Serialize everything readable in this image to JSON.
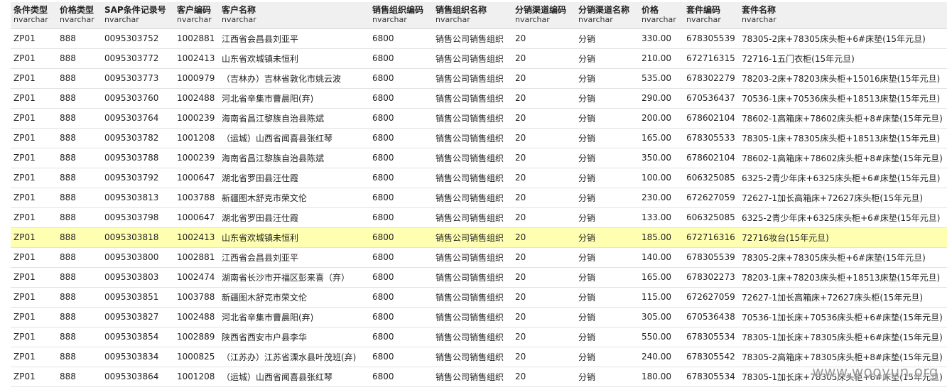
{
  "table": {
    "columns": [
      {
        "name": "条件类型",
        "type": "nvarchar"
      },
      {
        "name": "价格类型",
        "type": "nvarchar"
      },
      {
        "name": "SAP条件记录号",
        "type": "nvarchar"
      },
      {
        "name": "客户编码",
        "type": "nvarchar"
      },
      {
        "name": "客户名称",
        "type": "nvarchar"
      },
      {
        "name": "销售组织编码",
        "type": "nvarchar"
      },
      {
        "name": "销售组织名称",
        "type": "nvarchar"
      },
      {
        "name": "分销渠道编码",
        "type": "nvarchar"
      },
      {
        "name": "分销渠道名称",
        "type": "nvarchar"
      },
      {
        "name": "价格",
        "type": "nvarchar"
      },
      {
        "name": "套件编码",
        "type": "nvarchar"
      },
      {
        "name": "套件名称",
        "type": "nvarchar"
      }
    ],
    "rows": [
      [
        "ZP01",
        "888",
        "0095303752",
        "1002881",
        "江西省会昌县刘亚平",
        "6800",
        "销售公司销售组织",
        "20",
        "分销",
        "330.00",
        "678305539",
        "78305-2床+78305床头柜+6#床垫(15年元旦)"
      ],
      [
        "ZP01",
        "888",
        "0095303772",
        "1002413",
        "山东省欢城镇未恒利",
        "6800",
        "销售公司销售组织",
        "20",
        "分销",
        "210.00",
        "672716315",
        "72716-1五门衣柜(15年元旦)"
      ],
      [
        "ZP01",
        "888",
        "0095303773",
        "1000979",
        "（吉林办）吉林省敦化市姚云波",
        "6800",
        "销售公司销售组织",
        "20",
        "分销",
        "535.00",
        "678302279",
        "78203-2床+78203床头柜+15016床垫(15年元旦)"
      ],
      [
        "ZP01",
        "888",
        "0095303760",
        "1002488",
        "河北省辛集市曹晨阳(弃)",
        "6800",
        "销售公司销售组织",
        "20",
        "分销",
        "290.00",
        "670536437",
        "70536-1床+70536床头柜+18513床垫(15年元旦)"
      ],
      [
        "ZP01",
        "888",
        "0095303764",
        "1000239",
        "海南省昌江黎族自治县陈斌",
        "6800",
        "销售公司销售组织",
        "20",
        "分销",
        "200.00",
        "678602104",
        "78602-1高箱床+78602床头柜+8#床垫(15年元旦)"
      ],
      [
        "ZP01",
        "888",
        "0095303782",
        "1001208",
        "（运城）山西省闻喜县张红琴",
        "6800",
        "销售公司销售组织",
        "20",
        "分销",
        "165.00",
        "678305533",
        "78305-1床+78305床头柜+18513床垫(15年元旦)"
      ],
      [
        "ZP01",
        "888",
        "0095303788",
        "1000239",
        "海南省昌江黎族自治县陈斌",
        "6800",
        "销售公司销售组织",
        "20",
        "分销",
        "350.00",
        "678602104",
        "78602-1高箱床+78602床头柜+8#床垫(15年元旦)"
      ],
      [
        "ZP01",
        "888",
        "0095303792",
        "1000647",
        "湖北省罗田县汪仕霞",
        "6800",
        "销售公司销售组织",
        "20",
        "分销",
        "100.00",
        "606325085",
        "6325-2青少年床+6325床头柜+6#床垫(15年元旦)"
      ],
      [
        "ZP01",
        "888",
        "0095303813",
        "1003788",
        "新疆图木舒克市荣文伦",
        "6800",
        "销售公司销售组织",
        "20",
        "分销",
        "230.00",
        "672627059",
        "72627-1加长高箱床+72627床头柜(15年元旦)"
      ],
      [
        "ZP01",
        "888",
        "0095303798",
        "1000647",
        "湖北省罗田县汪仕霞",
        "6800",
        "销售公司销售组织",
        "20",
        "分销",
        "133.00",
        "606325085",
        "6325-2青少年床+6325床头柜+6#床垫(15年元旦)"
      ],
      [
        "ZP01",
        "888",
        "0095303818",
        "1002413",
        "山东省欢城镇未恒利",
        "6800",
        "销售公司销售组织",
        "20",
        "分销",
        "185.00",
        "672716316",
        "72716妆台(15年元旦)"
      ],
      [
        "ZP01",
        "888",
        "0095303800",
        "1002881",
        "江西省会昌县刘亚平",
        "6800",
        "销售公司销售组织",
        "20",
        "分销",
        "140.00",
        "678305539",
        "78305-2床+78305床头柜+6#床垫(15年元旦)"
      ],
      [
        "ZP01",
        "888",
        "0095303803",
        "1002474",
        "湖南省长沙市开福区彭来喜（弃）",
        "6800",
        "销售公司销售组织",
        "20",
        "分销",
        "165.00",
        "678302273",
        "78203-1床+78203床头柜+18513床垫(15年元旦)"
      ],
      [
        "ZP01",
        "888",
        "0095303851",
        "1003788",
        "新疆图木舒克市荣文伦",
        "6800",
        "销售公司销售组织",
        "20",
        "分销",
        "115.00",
        "672627059",
        "72627-1加长高箱床+72627床头柜(15年元旦)"
      ],
      [
        "ZP01",
        "888",
        "0095303827",
        "1002488",
        "河北省辛集市曹晨阳(弃)",
        "6800",
        "销售公司销售组织",
        "20",
        "分销",
        "305.00",
        "670536438",
        "70536-1加长床+70536床头柜+6#床垫(15年元旦)"
      ],
      [
        "ZP01",
        "888",
        "0095303854",
        "1002889",
        "陕西省西安市户县李华",
        "6800",
        "销售公司销售组织",
        "20",
        "分销",
        "550.00",
        "678305534",
        "78305-1加长床+78305床头柜+6#床垫(15年元旦)"
      ],
      [
        "ZP01",
        "888",
        "0095303834",
        "1000825",
        "（江苏办）江苏省溧水县叶茂班(弃)",
        "6800",
        "销售公司销售组织",
        "20",
        "分销",
        "240.00",
        "678305542",
        "78305-2高箱床+78305床头柜+8#床垫(15年元旦)"
      ],
      [
        "ZP01",
        "888",
        "0095303864",
        "1001208",
        "（运城）山西省闻喜县张红琴",
        "6800",
        "销售公司销售组织",
        "20",
        "分销",
        "180.00",
        "678305534",
        "78305-1加长床+78305床头柜+6#床垫(15年元旦)"
      ]
    ],
    "highlighted_row_index": 10,
    "highlight_color": "#ffffb2",
    "header_bg": "#f0f0f0"
  },
  "watermark": "www.wooyun.org"
}
